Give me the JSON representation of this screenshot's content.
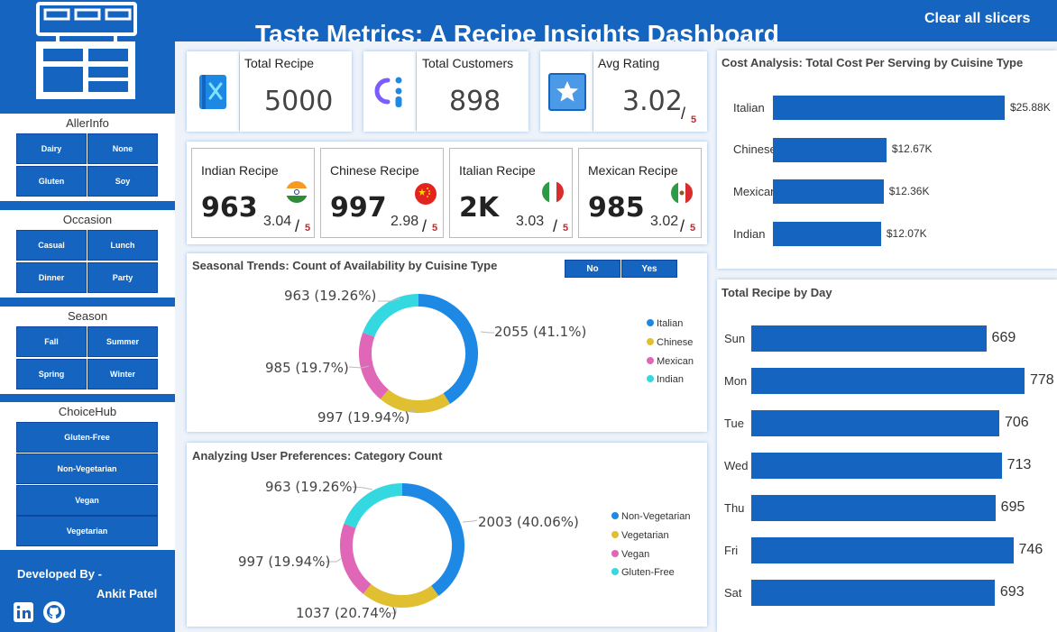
{
  "header": {
    "title": "Taste Metrics: A Recipe Insights Dashboard",
    "clear_slicers": "Clear all slicers"
  },
  "slicers": {
    "allerinfo": {
      "title": "AllerInfo",
      "options": [
        "Dairy",
        "None",
        "Gluten",
        "Soy"
      ]
    },
    "occasion": {
      "title": "Occasion",
      "options": [
        "Casual",
        "Lunch",
        "Dinner",
        "Party"
      ]
    },
    "season": {
      "title": "Season",
      "options": [
        "Fall",
        "Summer",
        "Spring",
        "Winter"
      ]
    },
    "choicehub": {
      "title": "ChoiceHub",
      "options": [
        "Gluten-Free",
        "Non-Vegetarian",
        "Vegan",
        "Vegetarian"
      ]
    }
  },
  "footer": {
    "developed_by": "Developed By -",
    "author": "Ankit Patel"
  },
  "kpis": {
    "total_recipe": {
      "label": "Total Recipe",
      "value": "5000"
    },
    "total_customers": {
      "label": "Total Customers",
      "value": "898"
    },
    "avg_rating": {
      "label": "Avg Rating",
      "value": "3.02",
      "slash": "/",
      "max": "5"
    }
  },
  "cuisines": [
    {
      "label": "Indian Recipe",
      "value": "963",
      "rating": "3.04",
      "slash": "/",
      "max": "5"
    },
    {
      "label": "Chinese Recipe",
      "value": "997",
      "rating": "2.98",
      "slash": "/",
      "max": "5"
    },
    {
      "label": "Italian Recipe",
      "value": "2K",
      "rating": "3.03",
      "slash": "/",
      "max": "5"
    },
    {
      "label": "Mexican Recipe",
      "value": "985",
      "rating": "3.02",
      "slash": "/",
      "max": "5"
    }
  ],
  "seasonal": {
    "title": "Seasonal Trends: Count of Availability by Cuisine Type",
    "toggle": [
      "No",
      "Yes"
    ],
    "labels": [
      "2055 (41.1%)",
      "997 (19.94%)",
      "985 (19.7%)",
      "963 (19.26%)"
    ],
    "legend": [
      "Italian",
      "Chinese",
      "Mexican",
      "Indian"
    ]
  },
  "preferences": {
    "title": "Analyzing User Preferences: Category Count",
    "labels": [
      "2003 (40.06%)",
      "1037 (20.74%)",
      "997 (19.94%)",
      "963 (19.26%)"
    ],
    "legend": [
      "Non-Vegetarian",
      "Vegetarian",
      "Vegan",
      "Gluten-Free"
    ]
  },
  "cost": {
    "title": "Cost Analysis: Total Cost Per Serving by Cuisine Type"
  },
  "by_day": {
    "title": "Total Recipe by Day"
  },
  "colors": {
    "brand": "#1565c0",
    "italian": "#1e88e5",
    "chinese": "#e0c030",
    "mexican": "#e066b8",
    "indian": "#34d8e0"
  },
  "chart_data": [
    {
      "type": "pie",
      "title": "Seasonal Trends: Count of Availability by Cuisine Type",
      "categories": [
        "Italian",
        "Chinese",
        "Mexican",
        "Indian"
      ],
      "values": [
        2055,
        997,
        985,
        963
      ]
    },
    {
      "type": "pie",
      "title": "Analyzing User Preferences: Category Count",
      "categories": [
        "Non-Vegetarian",
        "Vegetarian",
        "Vegan",
        "Gluten-Free"
      ],
      "values": [
        2003,
        1037,
        997,
        963
      ]
    },
    {
      "type": "bar",
      "title": "Cost Analysis: Total Cost Per Serving by Cuisine Type",
      "categories": [
        "Italian",
        "Chinese",
        "Mexican",
        "Indian"
      ],
      "values": [
        25880,
        12670,
        12360,
        12070
      ],
      "labels": [
        "$25.88K",
        "$12.67K",
        "$12.36K",
        "$12.07K"
      ]
    },
    {
      "type": "bar",
      "title": "Total Recipe by Day",
      "categories": [
        "Sun",
        "Mon",
        "Tue",
        "Wed",
        "Thu",
        "Fri",
        "Sat"
      ],
      "values": [
        669,
        778,
        706,
        713,
        695,
        746,
        693
      ]
    }
  ]
}
